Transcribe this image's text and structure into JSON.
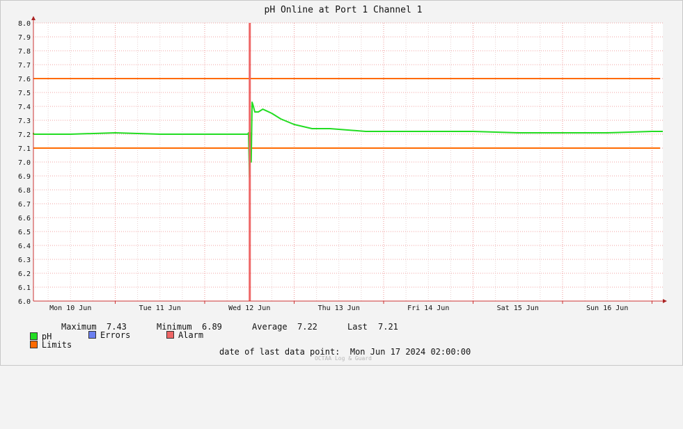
{
  "chart_data": {
    "type": "line",
    "title": "pH Online at Port 1 Channel 1",
    "xlabel": "",
    "ylabel": "",
    "ylim": [
      6.0,
      8.0
    ],
    "y_ticks": [
      "6.0",
      "6.1",
      "6.2",
      "6.3",
      "6.4",
      "6.5",
      "6.6",
      "6.7",
      "6.8",
      "6.9",
      "7.0",
      "7.1",
      "7.2",
      "7.3",
      "7.4",
      "7.5",
      "7.6",
      "7.7",
      "7.8",
      "7.9",
      "8.0"
    ],
    "x_range_days": [
      0,
      7.25
    ],
    "x_categories": [
      "Mon 10 Jun",
      "Tue 11 Jun",
      "Wed 12 Jun",
      "Thu 13 Jun",
      "Fri 14 Jun",
      "Sat 15 Jun",
      "Sun 16 Jun"
    ],
    "grid": true,
    "series": [
      {
        "name": "pH",
        "color": "#22dd22",
        "x_days": [
          -0.5,
          0.0,
          0.5,
          1.0,
          1.5,
          2.0,
          2.48,
          2.49,
          2.5,
          2.51,
          2.515,
          2.52,
          2.53,
          2.54,
          2.56,
          2.6,
          2.65,
          2.75,
          2.85,
          3.0,
          3.2,
          3.4,
          3.6,
          3.8,
          4.0,
          4.5,
          5.0,
          5.5,
          6.0,
          6.5,
          7.0,
          7.25
        ],
        "values": [
          7.21,
          7.2,
          7.2,
          7.21,
          7.2,
          7.2,
          7.2,
          7.21,
          6.89,
          7.21,
          7.2,
          7.0,
          7.43,
          7.41,
          7.36,
          7.36,
          7.38,
          7.35,
          7.31,
          7.27,
          7.24,
          7.24,
          7.23,
          7.22,
          7.22,
          7.22,
          7.22,
          7.21,
          7.21,
          7.21,
          7.22,
          7.22
        ]
      }
    ],
    "limits": {
      "name": "Limits",
      "color": "#ff6a00",
      "values": [
        7.1,
        7.6
      ]
    },
    "alarm": {
      "name": "Alarm",
      "color": "#ee6666",
      "x_days": 2.5
    },
    "errors": {
      "name": "Errors",
      "color": "#6b7ff0"
    }
  },
  "legend": {
    "ph_label": "pH",
    "max_label": "Maximum",
    "max_value": "7.43",
    "min_label": "Minimum",
    "min_value": "6.89",
    "avg_label": "Average",
    "avg_value": "7.22",
    "last_label": "Last",
    "last_value": "7.21",
    "limits_label": "Limits",
    "errors_label": "Errors",
    "alarm_label": "Alarm"
  },
  "footer": {
    "last_point_label": "date of last data point:",
    "last_point_value": "Mon Jun 17 2024 02:00:00",
    "watermark": "OCTAA Log & Guard"
  }
}
